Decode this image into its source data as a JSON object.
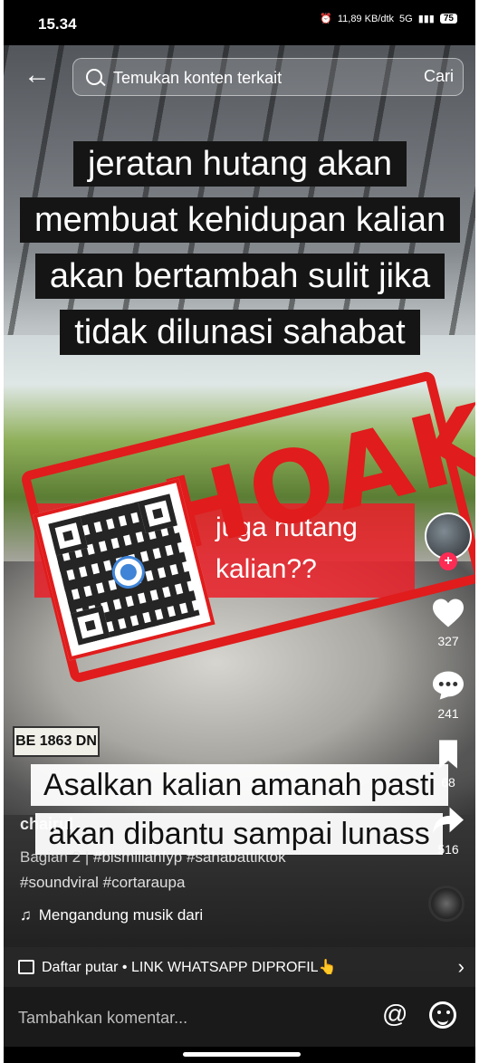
{
  "status": {
    "time": "15.34",
    "network": "5G",
    "data_rate": "11,89 KB/dtk",
    "battery": "75"
  },
  "search": {
    "placeholder": "Temukan konten terkait",
    "submit_label": "Cari"
  },
  "video": {
    "caption_top": "jeratan hutang akan membuat kehidupan kalian akan bertambah sulit jika tidak dilunasi sahabat",
    "caption_middle": "juga hutang kalian??",
    "caption_bottom": "Asalkan kalian amanah pasti akan dibantu sampai lunass",
    "plate": "BE 1863 DN",
    "stamp": "HOAKS"
  },
  "rail": {
    "likes": "327",
    "comments": "241",
    "saves": "68",
    "shares": "516"
  },
  "meta": {
    "username": "chairul",
    "part": "Bagian 2 |",
    "hashtags_line1": "#bismillahfyp #sahabattiktok",
    "hashtags_line2": "#soundviral #cortaraupa",
    "music": "Mengandung musik dari"
  },
  "playlist": {
    "label": "Daftar putar • LINK WHATSAPP DIPROFIL👆"
  },
  "comment": {
    "placeholder": "Tambahkan komentar..."
  },
  "colors": {
    "stamp_red": "#e01c1c",
    "follow_pink": "#fe2c55",
    "kominfo_blue": "#1f6fd1"
  }
}
